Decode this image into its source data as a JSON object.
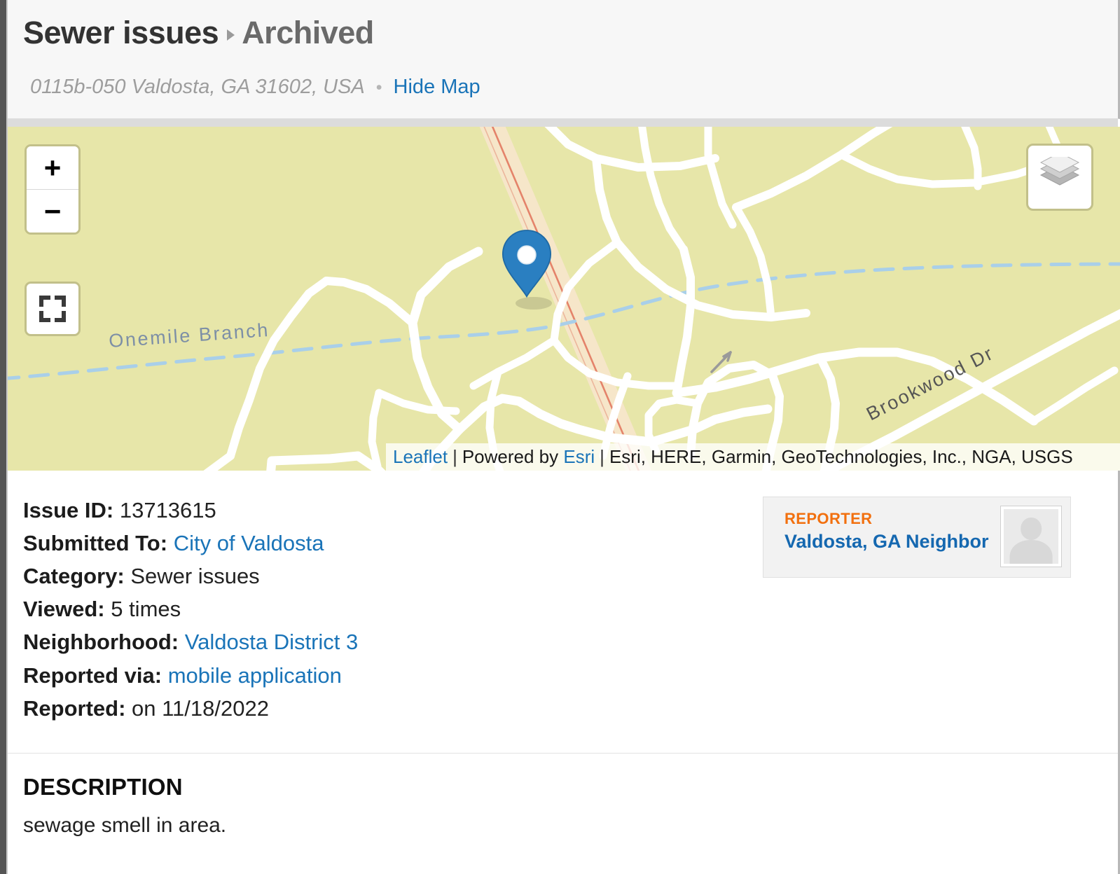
{
  "header": {
    "title": "Sewer issues",
    "separator_icon": "caret-right-icon",
    "status": "Archived",
    "address": "0115b-050 Valdosta, GA 31602, USA",
    "bullet": "•",
    "hide_map_label": "Hide Map"
  },
  "map": {
    "background_color": "#e7e6a9",
    "road_color": "#ffffff",
    "highway_fill": "#f7e3c6",
    "highway_line": "#e07a5f",
    "stream_color": "#aacfe8",
    "marker_color": "#2a7fc1",
    "controls": {
      "zoom_in": "+",
      "zoom_out": "−",
      "fullscreen_icon": "fullscreen-icon",
      "layers_icon": "layers-icon"
    },
    "labels": [
      {
        "text": "Onemile Branch",
        "type": "stream"
      },
      {
        "text": "Brookwood Dr",
        "type": "road"
      }
    ],
    "attribution": {
      "leaflet": "Leaflet",
      "sep1": "|",
      "powered_by": "Powered by",
      "esri_link": "Esri",
      "sep2": "|",
      "credits": "Esri, HERE, Garmin, GeoTechnologies, Inc., NGA, USGS"
    }
  },
  "details": [
    {
      "label": "Issue ID:",
      "value": "13713615",
      "is_link": false
    },
    {
      "label": "Submitted To:",
      "value": "City of Valdosta",
      "is_link": true
    },
    {
      "label": "Category:",
      "value": "Sewer issues",
      "is_link": false
    },
    {
      "label": "Viewed:",
      "value": "5 times",
      "is_link": false
    },
    {
      "label": "Neighborhood:",
      "value": "Valdosta District 3",
      "is_link": true
    },
    {
      "label": "Reported via:",
      "value": "mobile application",
      "is_link": true
    },
    {
      "label": "Reported:",
      "value": "on 11/18/2022",
      "is_link": false
    }
  ],
  "detail_lines": {
    "l0_label": "Issue ID:",
    "l0_value": "13713615",
    "l1_label": "Submitted To:",
    "l1_value": "City of Valdosta",
    "l2_label": "Category:",
    "l2_value": "Sewer issues",
    "l3_label": "Viewed:",
    "l3_value": "5 times",
    "l4_label": "Neighborhood:",
    "l4_value": "Valdosta District 3",
    "l5_label": "Reported via:",
    "l5_value": "mobile application",
    "l6_label": "Reported:",
    "l6_value": "on 11/18/2022"
  },
  "reporter": {
    "heading": "REPORTER",
    "name": "Valdosta, GA Neighbor",
    "heading_color": "#f2700f",
    "name_color": "#1568b0",
    "avatar_icon": "user-avatar-placeholder-icon"
  },
  "description": {
    "heading": "DESCRIPTION",
    "text": "sewage smell in area."
  },
  "colors": {
    "link": "#1a74b8",
    "header_bg": "#f7f7f7",
    "text": "#222222"
  }
}
